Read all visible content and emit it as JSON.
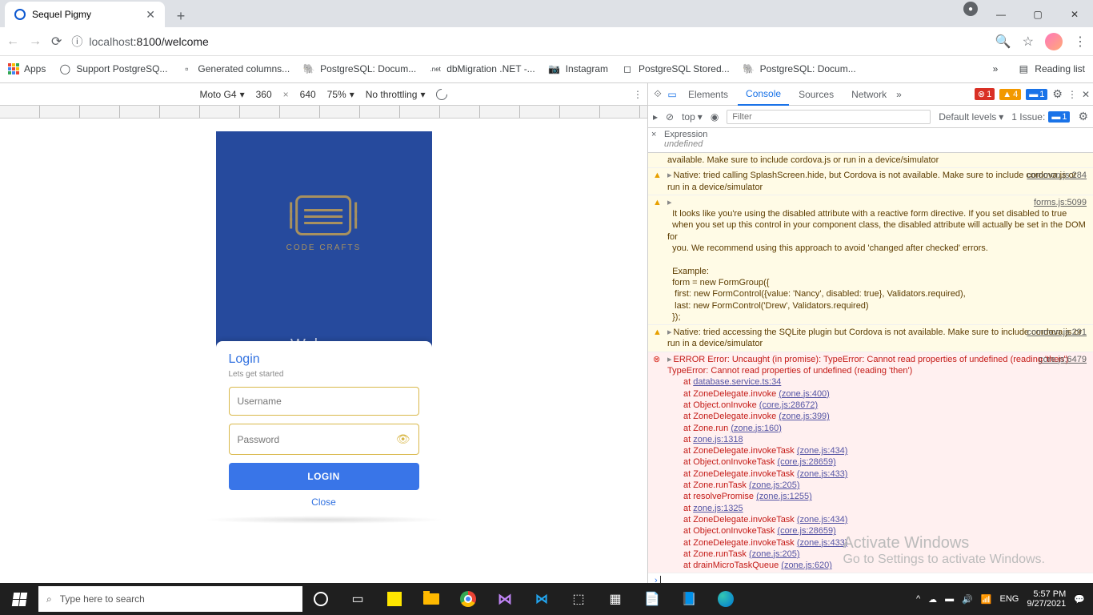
{
  "browser": {
    "tab_title": "Sequel Pigmy",
    "url_host": "localhost",
    "url_rest": ":8100/welcome"
  },
  "bookmarks": {
    "apps": "Apps",
    "items": [
      "Support PostgreSQ...",
      "Generated columns...",
      "PostgreSQL: Docum...",
      "dbMigration .NET -...",
      "Instagram",
      "PostgreSQL Stored...",
      "PostgreSQL: Docum..."
    ],
    "reading_list": "Reading list"
  },
  "device_toolbar": {
    "device": "Moto G4",
    "width": "360",
    "height": "640",
    "zoom": "75%",
    "throttle": "No throttling"
  },
  "app": {
    "logo_text": "CODE CRAFTS",
    "welcome": "Welcome",
    "login_title": "Login",
    "login_sub": "Lets get started",
    "username_ph": "Username",
    "password_ph": "Password",
    "login_btn": "LOGIN",
    "close": "Close"
  },
  "devtools": {
    "tabs": {
      "elements": "Elements",
      "console": "Console",
      "sources": "Sources",
      "network": "Network"
    },
    "badges": {
      "errors": "1",
      "warnings": "4",
      "info": "1"
    },
    "subbar": {
      "top": "top",
      "filter_ph": "Filter",
      "levels": "Default levels",
      "issues_label": "1 Issue:",
      "issues_count": "1"
    },
    "watch": {
      "expr": "Expression",
      "undef": "undefined"
    },
    "msgs": {
      "warn_trunc": "available. Make sure to include cordova.js or run in a device/simulator",
      "warn1": "Native: tried calling SplashScreen.hide, but Cordova is not available. Make sure to include cordova.js or run in a device/simulator",
      "warn1_src": "common.js:284",
      "warn2_src": "forms.js:5099",
      "warn2_l1": "It looks like you're using the disabled attribute with a reactive form directive. If you set disabled to true",
      "warn2_l2": "when you set up this control in your component class, the disabled attribute will actually be set in the DOM for",
      "warn2_l3": "you. We recommend using this approach to avoid 'changed after checked' errors.",
      "warn2_ex": "Example:",
      "warn2_c1": "form = new FormGroup({",
      "warn2_c2": "  first: new FormControl({value: 'Nancy', disabled: true}, Validators.required),",
      "warn2_c3": "  last: new FormControl('Drew', Validators.required)",
      "warn2_c4": "});",
      "warn3": "Native: tried accessing the SQLite plugin but Cordova is not available. Make sure to include cordova.js or run in a device/simulator",
      "warn3_src": "common.js:291",
      "err_src": "core.js:6479",
      "err_l1": "ERROR Error: Uncaught (in promise): TypeError: Cannot read properties of undefined (reading 'then')",
      "err_l2": "TypeError: Cannot read properties of undefined (reading 'then')",
      "stack": [
        {
          "at": "at ",
          "txt": "database.service.ts:34",
          "link": ""
        },
        {
          "at": "at ZoneDelegate.invoke ",
          "txt": "",
          "link": "(zone.js:400)"
        },
        {
          "at": "at Object.onInvoke ",
          "txt": "",
          "link": "(core.js:28672)"
        },
        {
          "at": "at ZoneDelegate.invoke ",
          "txt": "",
          "link": "(zone.js:399)"
        },
        {
          "at": "at Zone.run ",
          "txt": "",
          "link": "(zone.js:160)"
        },
        {
          "at": "at ",
          "txt": "",
          "link": "zone.js:1318"
        },
        {
          "at": "at ZoneDelegate.invokeTask ",
          "txt": "",
          "link": "(zone.js:434)"
        },
        {
          "at": "at Object.onInvokeTask ",
          "txt": "",
          "link": "(core.js:28659)"
        },
        {
          "at": "at ZoneDelegate.invokeTask ",
          "txt": "",
          "link": "(zone.js:433)"
        },
        {
          "at": "at Zone.runTask ",
          "txt": "",
          "link": "(zone.js:205)"
        },
        {
          "at": "at resolvePromise ",
          "txt": "",
          "link": "(zone.js:1255)"
        },
        {
          "at": "at ",
          "txt": "",
          "link": "zone.js:1325"
        },
        {
          "at": "at ZoneDelegate.invokeTask ",
          "txt": "",
          "link": "(zone.js:434)"
        },
        {
          "at": "at Object.onInvokeTask ",
          "txt": "",
          "link": "(core.js:28659)"
        },
        {
          "at": "at ZoneDelegate.invokeTask ",
          "txt": "",
          "link": "(zone.js:433)"
        },
        {
          "at": "at Zone.runTask ",
          "txt": "",
          "link": "(zone.js:205)"
        },
        {
          "at": "at drainMicroTaskQueue ",
          "txt": "",
          "link": "(zone.js:620)"
        }
      ]
    }
  },
  "watermark": {
    "t1": "Activate Windows",
    "t2": "Go to Settings to activate Windows."
  },
  "taskbar": {
    "search_ph": "Type here to search",
    "time": "5:57 PM",
    "date": "9/27/2021"
  }
}
